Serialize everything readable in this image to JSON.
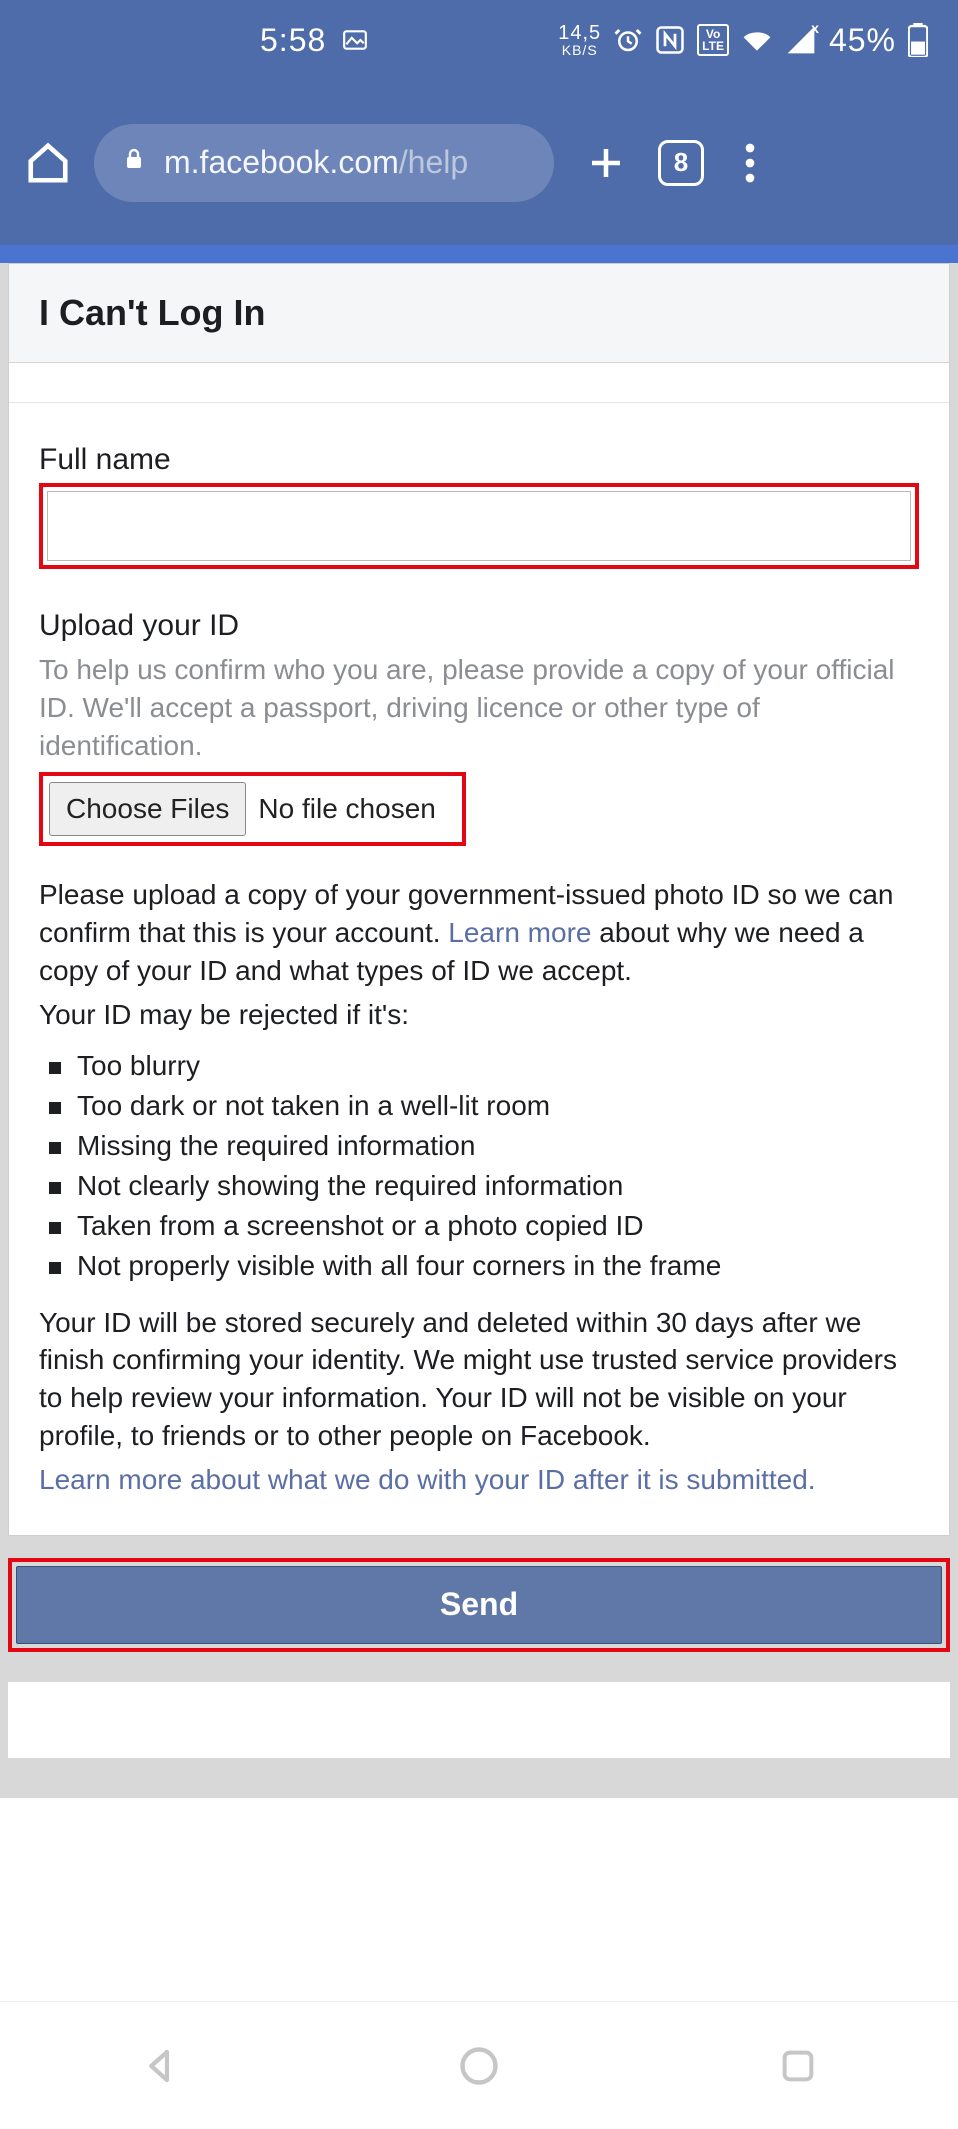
{
  "status": {
    "time": "5:58",
    "net_speed_value": "14,5",
    "net_speed_unit": "KB/S",
    "lte_badge": "Vo\nLTE",
    "battery_percent": "45%"
  },
  "chrome": {
    "url_host": "m.facebook.com",
    "url_path": "/help",
    "tab_count": "8"
  },
  "page": {
    "title": "I Can't Log In",
    "full_name_label": "Full name",
    "full_name_value": "",
    "upload_label": "Upload your ID",
    "upload_help": "To help us confirm who you are, please provide a copy of your official ID. We'll accept a passport, driving licence or other type of identification.",
    "choose_files_label": "Choose Files",
    "no_file_text": "No file chosen",
    "p1_a": "Please upload a copy of your government-issued photo ID so we can confirm that this is your account. ",
    "learn_more_1": "Learn more",
    "p1_b": " about why we need a copy of your ID and what types of ID we accept.",
    "reject_intro": "Your ID may be rejected if it's:",
    "rejects": [
      "Too blurry",
      "Too dark or not taken in a well-lit room",
      "Missing the required information",
      "Not clearly showing the required information",
      "Taken from a screenshot or a photo copied ID",
      "Not properly visible with all four corners in the frame"
    ],
    "p2": "Your ID will be stored securely and deleted within 30 days after we finish confirming your identity. We might use trusted service providers to help review your information. Your ID will not be visible on your profile, to friends or to other people on Facebook.",
    "learn_more_2": "Learn more about what we do with your ID after it is submitted.",
    "send_label": "Send"
  }
}
